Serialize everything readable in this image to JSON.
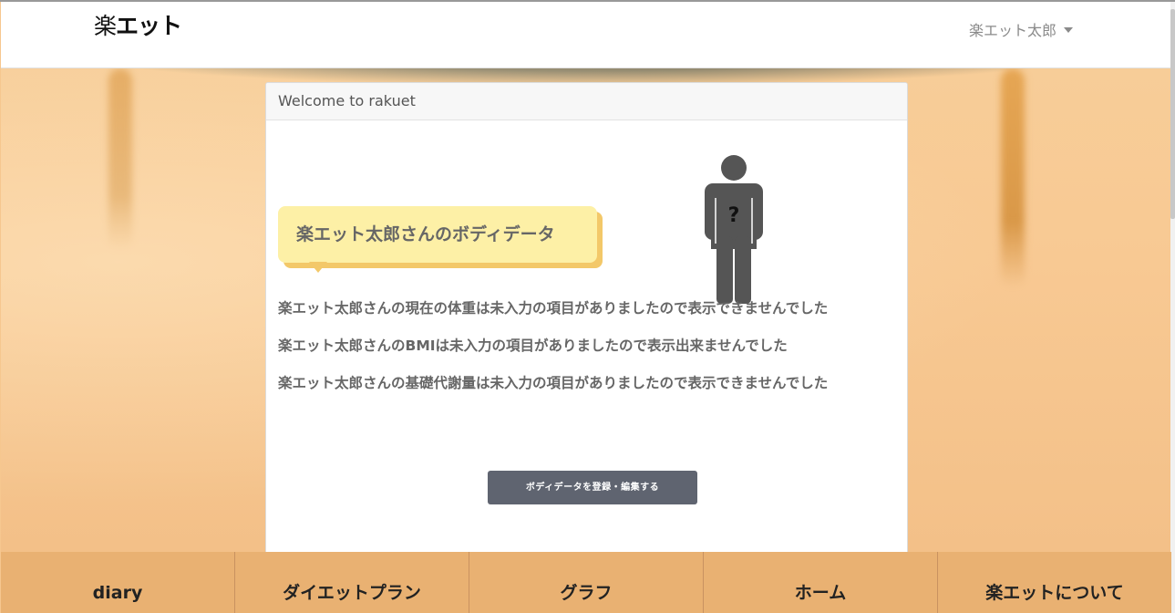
{
  "header": {
    "brand_part1": "楽",
    "brand_part2": "エット",
    "user_name": "楽エット太郎"
  },
  "card": {
    "title": "Welcome to rakuet",
    "bubble_text": "楽エット太郎さんのボディデータ",
    "figure_mark": "?",
    "lines": [
      "楽エット太郎さんの現在の体重は未入力の項目がありましたので表示できませんでした",
      "楽エット太郎さんのBMIは未入力の項目がありましたので表示出来ませんでした",
      "楽エット太郎さんの基礎代謝量は未入力の項目がありましたので表示できませんでした"
    ],
    "edit_button": "ボディデータを登録・編集する"
  },
  "bottom_nav": [
    {
      "label": "diary"
    },
    {
      "label": "ダイエットプラン"
    },
    {
      "label": "グラフ"
    },
    {
      "label": "ホーム"
    },
    {
      "label": "楽エットについて"
    }
  ],
  "colors": {
    "navbar_bg": "#ffffff",
    "bubble_bg": "#fdf0a6",
    "button_bg": "#5f6470",
    "bottom_nav_bg": "#e9b172"
  }
}
